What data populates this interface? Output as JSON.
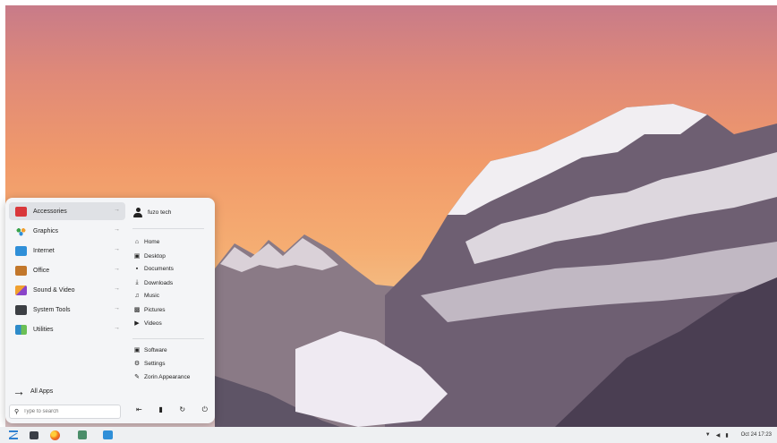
{
  "start_menu": {
    "categories": [
      {
        "label": "Accessories",
        "icon": "toolbox-icon",
        "color": "#d9373a"
      },
      {
        "label": "Graphics",
        "icon": "palette-icon",
        "color": "#f0a030"
      },
      {
        "label": "Internet",
        "icon": "cloud-icon",
        "color": "#2f8fd8"
      },
      {
        "label": "Office",
        "icon": "briefcase-icon",
        "color": "#c2772b"
      },
      {
        "label": "Sound & Video",
        "icon": "media-icon",
        "color": "#e0522e"
      },
      {
        "label": "System Tools",
        "icon": "monitor-icon",
        "color": "#3c3f44"
      },
      {
        "label": "Utilities",
        "icon": "utilities-icon",
        "color": "#2e8bc9"
      }
    ],
    "all_apps_label": "All Apps",
    "search_placeholder": "Type to search",
    "user_name": "fuzo tech",
    "places": [
      {
        "label": "Home",
        "icon": "home-icon"
      },
      {
        "label": "Desktop",
        "icon": "desktop-icon"
      },
      {
        "label": "Documents",
        "icon": "document-icon"
      },
      {
        "label": "Downloads",
        "icon": "download-icon"
      },
      {
        "label": "Music",
        "icon": "music-icon"
      },
      {
        "label": "Pictures",
        "icon": "pictures-icon"
      },
      {
        "label": "Videos",
        "icon": "video-icon"
      }
    ],
    "system_links": [
      {
        "label": "Software",
        "icon": "software-icon"
      },
      {
        "label": "Settings",
        "icon": "settings-icon"
      },
      {
        "label": "Zorin Appearance",
        "icon": "appearance-icon"
      }
    ],
    "power_actions": [
      "logout-icon",
      "lock-icon",
      "restart-icon",
      "power-icon"
    ]
  },
  "taskbar": {
    "clock": "Oct 24  17:23",
    "launchers": [
      "zorin-menu-icon",
      "terminal-icon",
      "firefox-icon",
      "files-icon",
      "software-store-icon"
    ],
    "tray_icons": [
      "network-icon",
      "volume-icon",
      "battery-icon"
    ]
  }
}
